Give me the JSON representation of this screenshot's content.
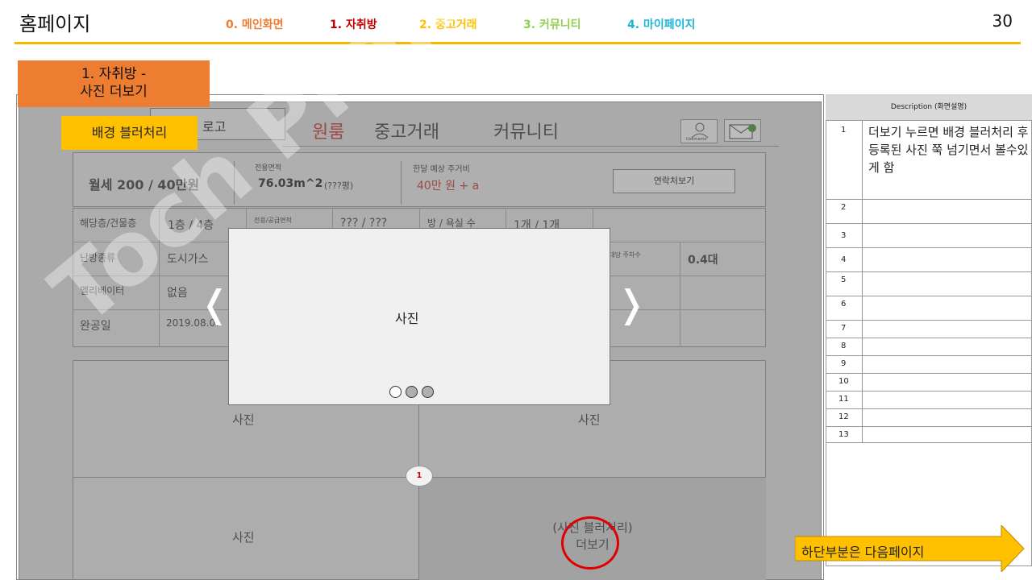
{
  "header": {
    "title": "홈페이지",
    "nav": [
      {
        "label": "0. 메인화면",
        "color": "#ed7d31"
      },
      {
        "label": "1. 자취방",
        "color": "#c00000"
      },
      {
        "label": "2. 중고거래",
        "color": "#ffc000"
      },
      {
        "label": "3. 커뮤니티",
        "color": "#92d050"
      },
      {
        "label": "4. 마이페이지",
        "color": "#1cb5d6"
      }
    ],
    "page_number": "30"
  },
  "section_label": {
    "line1": "1. 자취방 -",
    "line2": "사진 더보기"
  },
  "mock": {
    "logo_text": "로고",
    "nav": [
      "원룸",
      "중고거래",
      "커뮤니티"
    ],
    "user_caption": "Username",
    "rent": "월세 200 / 40만원",
    "area_label": "전용면적",
    "area_value": "76.03m^2",
    "area_note": "(???평)",
    "cost_label": "한달 예상 주거비",
    "cost_value": "40만 원 + a",
    "contact_button": "연락처보기",
    "table": {
      "r1c1": "해당층/건물층",
      "r1c2": "1층 / 4층",
      "r1c3": "전용/공급면적",
      "r1c4": "??? / ???",
      "r1c5": "방 / 욕실 수",
      "r1c6": "1개 / 1개",
      "r2c1": "난방종류",
      "r2c2": "도시가스",
      "r2c5": "세대당 주차수",
      "r2c6": "0.4대",
      "r3c1": "엘리베이터",
      "r3c2": "없음",
      "r4c1": "완공일",
      "r4c2": "2019.08.01"
    },
    "photos": [
      "사진",
      "사진",
      "사진"
    ],
    "more_line1": "(사진 블러처리)",
    "more_line2": "더보기",
    "badge": "1"
  },
  "overlay": {
    "blur_label": "배경 블러처리",
    "photo_label": "사진",
    "prev_arrow": "❬",
    "next_arrow": "❭"
  },
  "watermark": "Toch Project",
  "description": {
    "title": "Description (화면설명)",
    "rows": [
      {
        "num": "1",
        "text": "더보기 누르면 배경 블러처리 후 등록된 사진 쭉 넘기면서 볼수있게 함"
      },
      {
        "num": "2"
      },
      {
        "num": "3"
      },
      {
        "num": "4"
      },
      {
        "num": "5"
      },
      {
        "num": "6"
      },
      {
        "num": "7"
      },
      {
        "num": "8"
      },
      {
        "num": "9"
      },
      {
        "num": "10"
      },
      {
        "num": "11"
      },
      {
        "num": "12"
      },
      {
        "num": "13"
      }
    ]
  },
  "next_page_label": "하단부분은 다음페이지"
}
